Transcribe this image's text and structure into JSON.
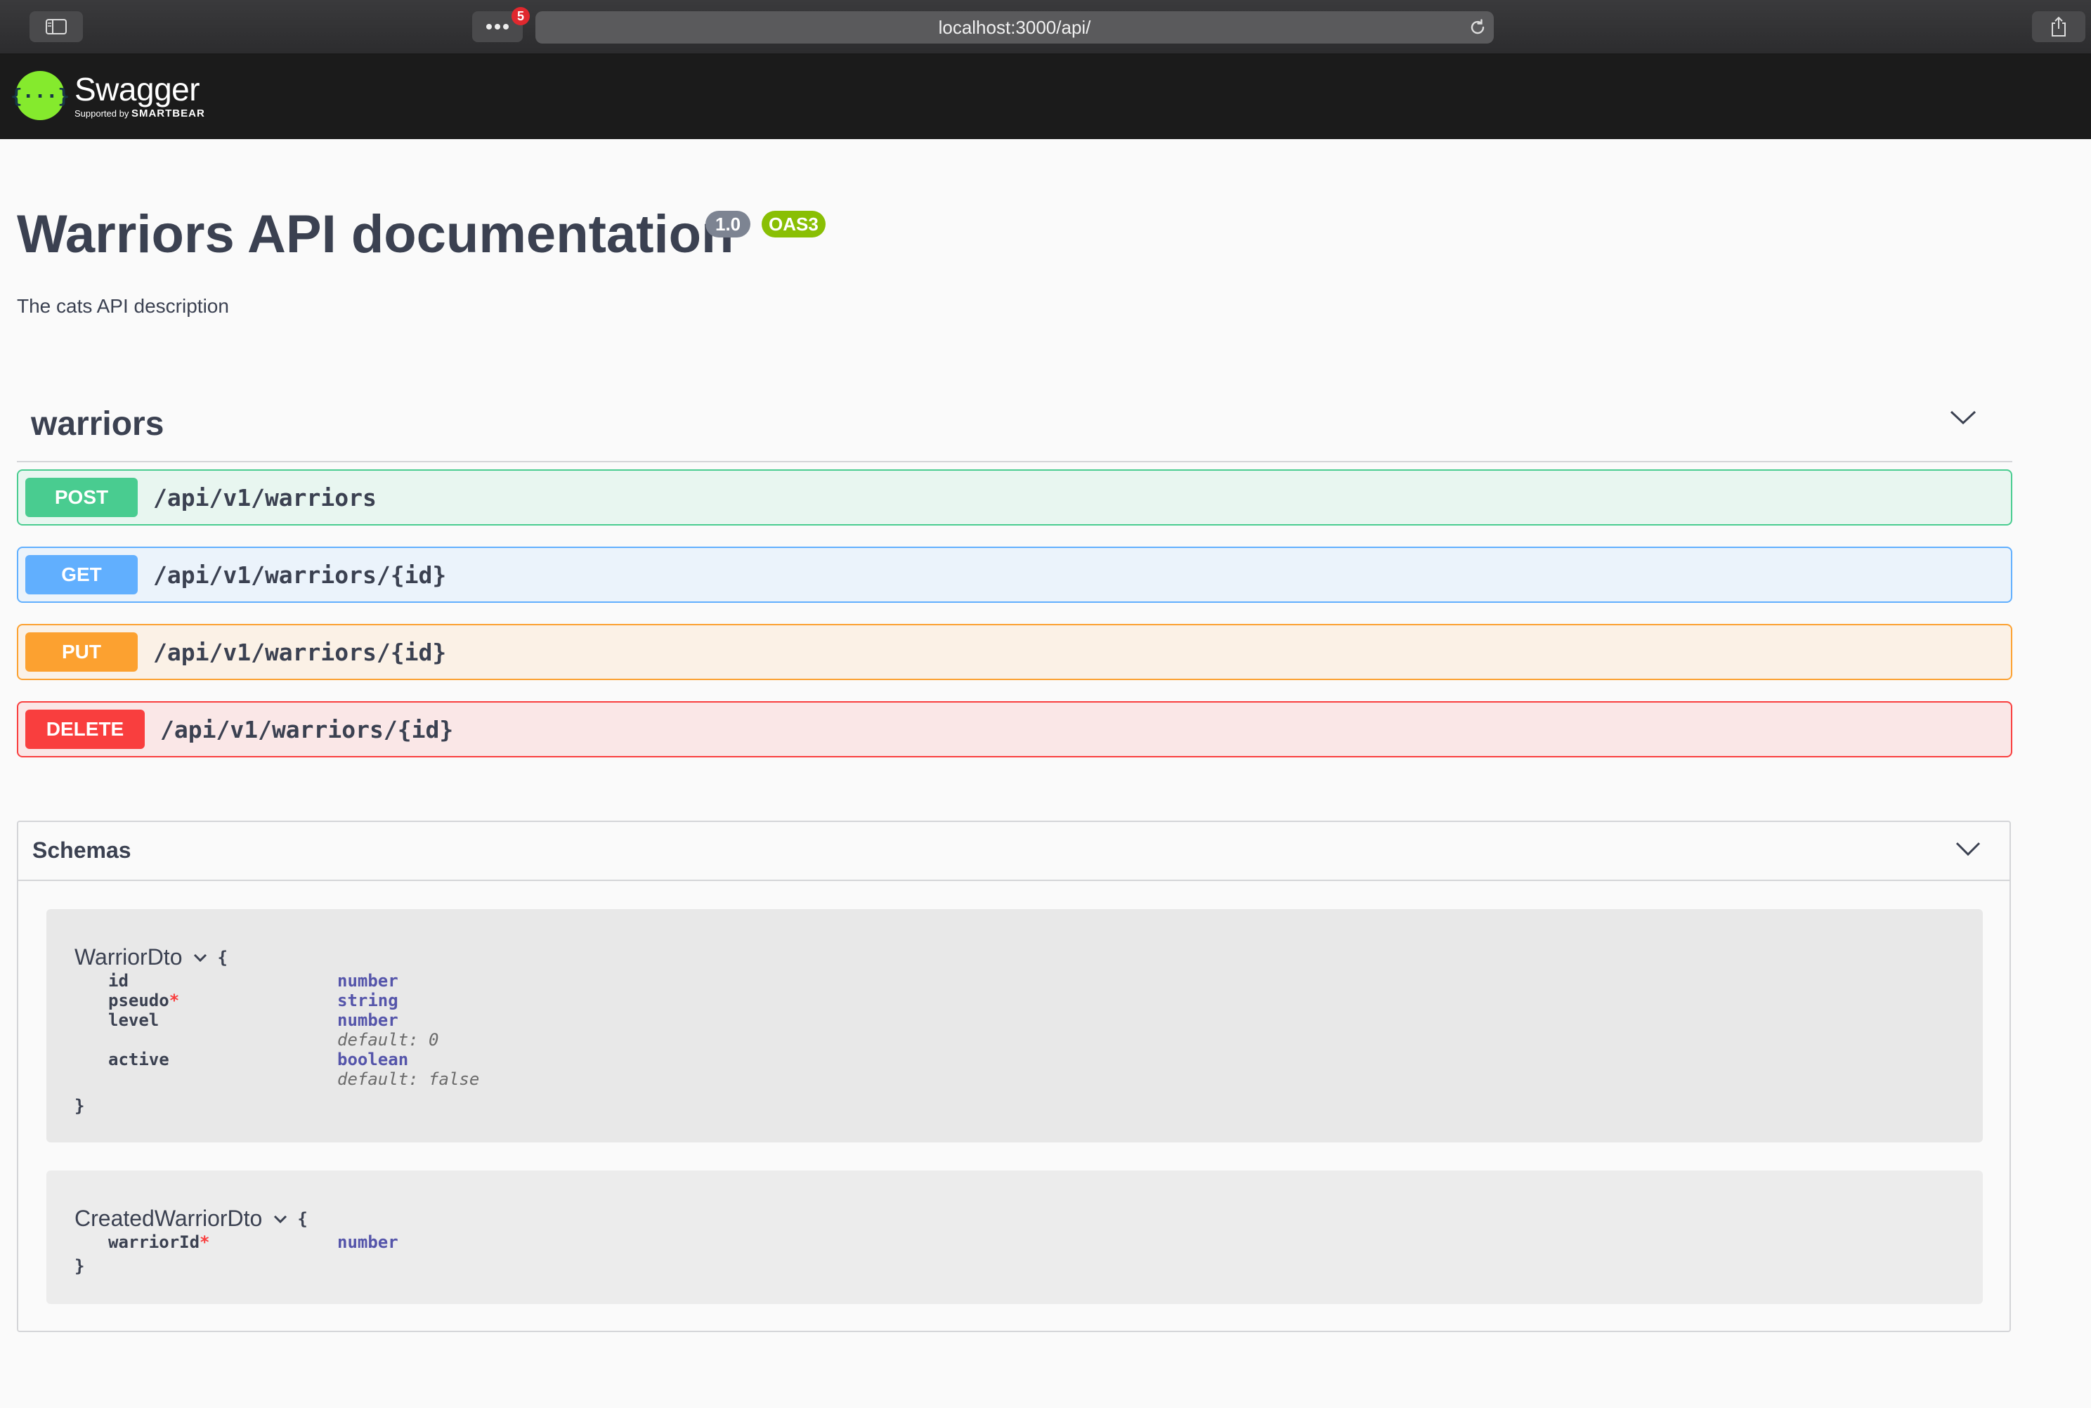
{
  "browser": {
    "url": "localhost:3000/api/",
    "extensions_badge": "5"
  },
  "topbar": {
    "logo_symbol": "{···}",
    "logo_name": "Swagger",
    "logo_tagline_prefix": "Supported by",
    "logo_tagline_brand": "SMARTBEAR"
  },
  "info": {
    "title": "Warriors API documentation",
    "version": "1.0",
    "spec": "OAS3",
    "description": "The cats API description"
  },
  "tag": {
    "name": "warriors",
    "operations": [
      {
        "method": "POST",
        "path": "/api/v1/warriors",
        "color": "#49cc90"
      },
      {
        "method": "GET",
        "path": "/api/v1/warriors/{id}",
        "color": "#61affe"
      },
      {
        "method": "PUT",
        "path": "/api/v1/warriors/{id}",
        "color": "#fca130"
      },
      {
        "method": "DELETE",
        "path": "/api/v1/warriors/{id}",
        "color": "#f93e3e"
      }
    ]
  },
  "schemas": {
    "title": "Schemas",
    "models": [
      {
        "name": "WarriorDto",
        "open_brace": "{",
        "close_brace": "}",
        "properties": [
          {
            "name": "id",
            "required": false,
            "type": "number"
          },
          {
            "name": "pseudo",
            "required": true,
            "type": "string"
          },
          {
            "name": "level",
            "required": false,
            "type": "number",
            "default": "default: 0"
          },
          {
            "name": "active",
            "required": false,
            "type": "boolean",
            "default": "default: false"
          }
        ]
      },
      {
        "name": "CreatedWarriorDto",
        "open_brace": "{",
        "close_brace": "}",
        "properties": [
          {
            "name": "warriorId",
            "required": true,
            "type": "number"
          }
        ]
      }
    ],
    "required_marker": "*"
  }
}
